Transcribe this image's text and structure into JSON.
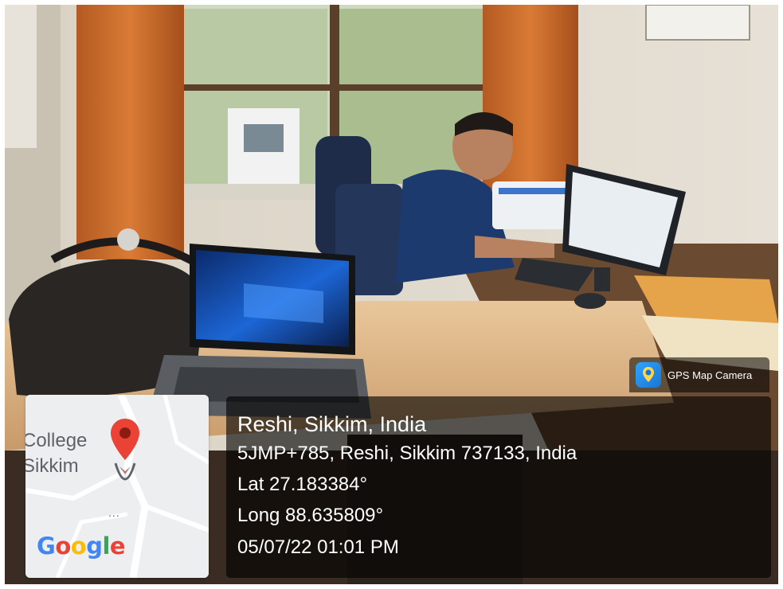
{
  "watermark": {
    "app_name": "GPS Map Camera",
    "icon": "gps-map-camera-app-icon"
  },
  "map": {
    "label_line1": "College",
    "label_line2": "Sikkim",
    "dots": "...",
    "logo_text": [
      "G",
      "o",
      "o",
      "g",
      "l",
      "e"
    ],
    "pin_icon": "map-pin-icon",
    "pin_color": "#EA4335"
  },
  "location": {
    "title": "Reshi, Sikkim, India",
    "address": "5JMP+785, Reshi, Sikkim 737133, India",
    "latitude": "Lat 27.183384°",
    "longitude": "Long 88.635809°",
    "datetime": "05/07/22 01:01 PM"
  }
}
